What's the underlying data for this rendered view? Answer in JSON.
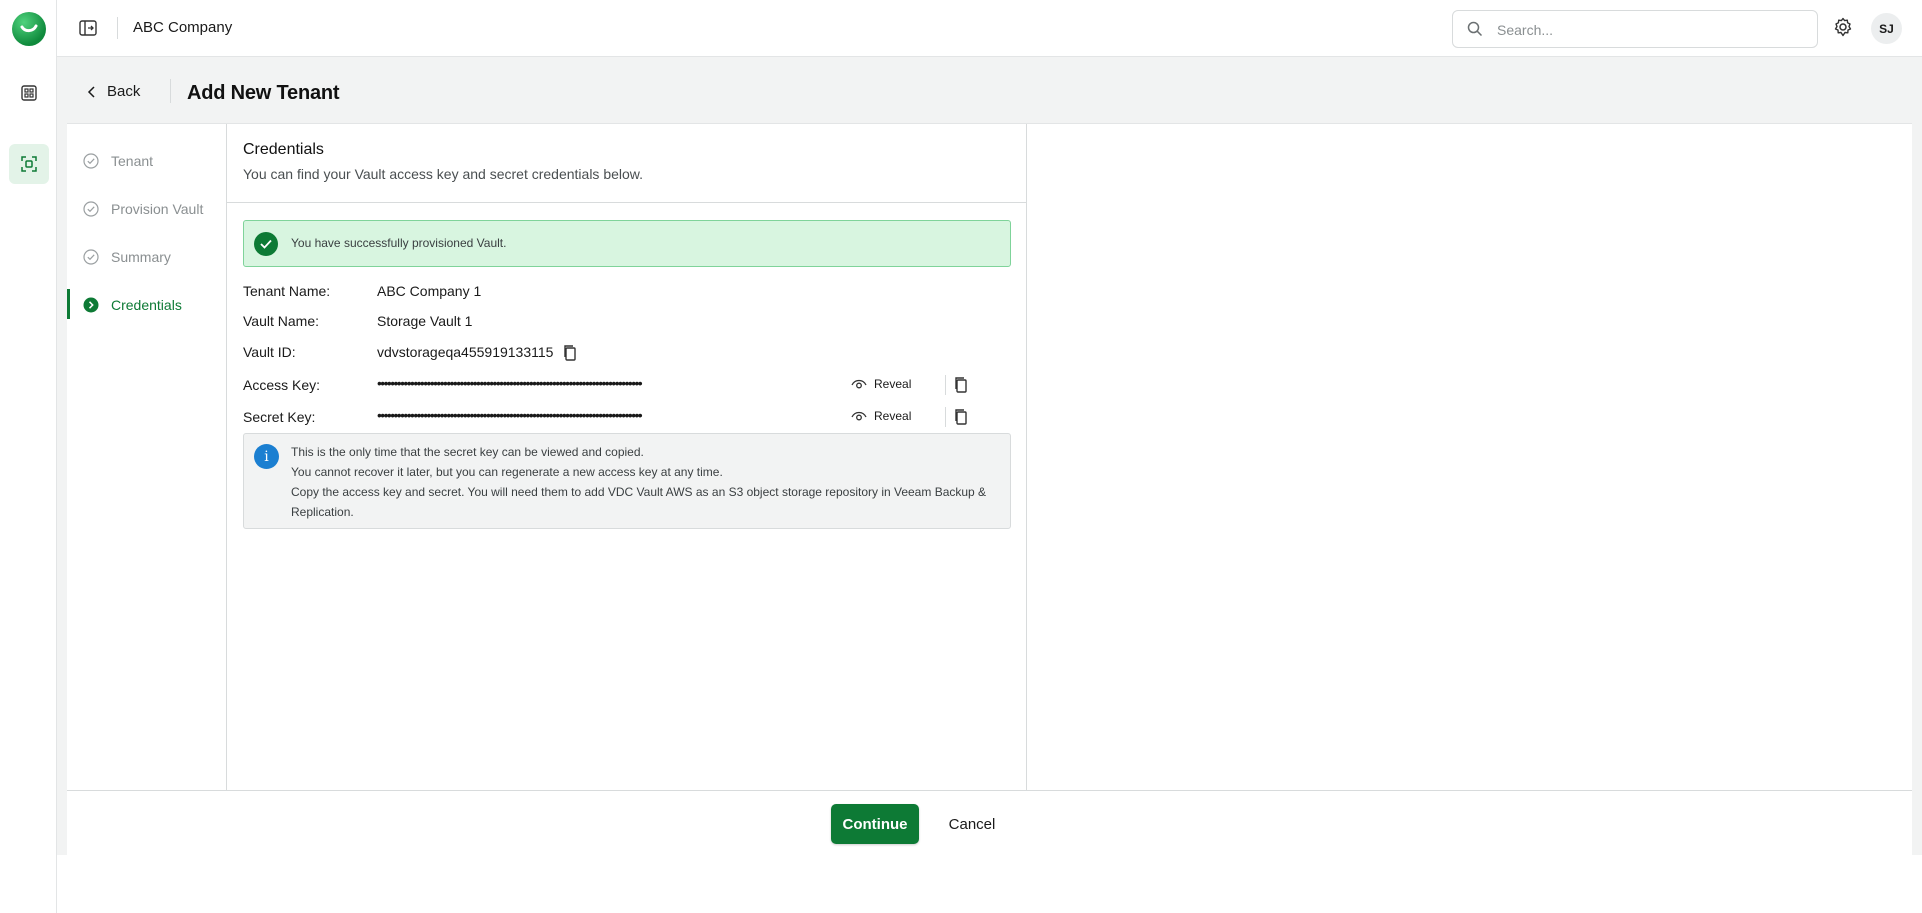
{
  "app": {
    "company": "ABC Company",
    "search_placeholder": "Search...",
    "user_initials": "SJ"
  },
  "header": {
    "back_label": "Back",
    "title": "Add New Tenant"
  },
  "steps": [
    {
      "label": "Tenant",
      "state": "done"
    },
    {
      "label": "Provision Vault",
      "state": "done"
    },
    {
      "label": "Summary",
      "state": "done"
    },
    {
      "label": "Credentials",
      "state": "current"
    }
  ],
  "credentials": {
    "title": "Credentials",
    "subtitle": "You can find your Vault access key and secret credentials below.",
    "success_message": "You have successfully provisioned Vault.",
    "tenant_name_label": "Tenant Name:",
    "tenant_name": "ABC Company 1",
    "vault_name_label": "Vault Name:",
    "vault_name": "Storage Vault 1",
    "vault_id_label": "Vault ID:",
    "vault_id": "vdvstorageqa455919133115",
    "access_key_label": "Access Key:",
    "access_key_masked": "••••••••••••••••••••••••••••••••••••••••••••••••••••••••••••••••••••••••••••••••",
    "secret_key_label": "Secret Key:",
    "secret_key_masked": "••••••••••••••••••••••••••••••••••••••••••••••••••••••••••••••••••••••••••••••••",
    "reveal_label": "Reveal",
    "info_lines": [
      "This is the only time that the secret key can be viewed and copied.",
      "You cannot recover it later, but you can regenerate a new access key at any time.",
      "Copy the access key and secret. You will need them to add VDC Vault AWS as an S3 object storage repository in Veeam Backup & Replication."
    ]
  },
  "footer": {
    "continue_label": "Continue",
    "cancel_label": "Cancel"
  },
  "colors": {
    "accent_green": "#0d7a35",
    "success_bg": "#d8f5e0",
    "info_blue": "#1b7fd1"
  }
}
